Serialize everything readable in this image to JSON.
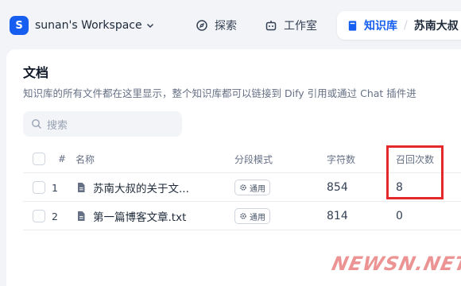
{
  "workspace": {
    "initial": "S",
    "name": "sunan's Workspace"
  },
  "nav": {
    "explore": "探索",
    "studio": "工作室",
    "knowledge": "知识库",
    "current_kb": "苏南大叔"
  },
  "page": {
    "title": "文档",
    "description": "知识库的所有文件都在这里显示，整个知识库都可以链接到 Dify 引用或通过 Chat 插件进",
    "search_placeholder": "搜索"
  },
  "table": {
    "headers": {
      "index": "#",
      "name": "名称",
      "mode": "分段模式",
      "chars": "字符数",
      "recall": "召回次数"
    },
    "rows": [
      {
        "index": "1",
        "name": "苏南大叔的关于文...",
        "mode": "通用",
        "chars": "854",
        "recall": "8"
      },
      {
        "index": "2",
        "name": "第一篇博客文章.txt",
        "mode": "通用",
        "chars": "814",
        "recall": "0"
      }
    ]
  },
  "watermark": "NEWSN.NET",
  "colors": {
    "accent": "#155eef",
    "highlight": "#e5292a"
  }
}
